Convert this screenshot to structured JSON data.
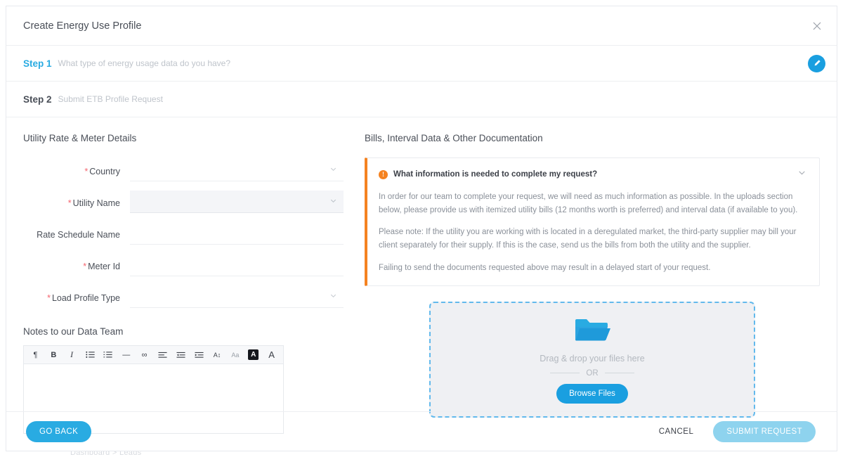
{
  "header": {
    "title": "Create Energy Use Profile",
    "close_icon": "close-icon"
  },
  "steps": [
    {
      "label": "Step 1",
      "subtitle": "What type of energy usage data do you have?",
      "badge_icon": "edit-pencil-icon"
    },
    {
      "label": "Step 2",
      "subtitle": "Submit ETB Profile Request"
    }
  ],
  "left": {
    "section_title": "Utility Rate & Meter Details",
    "fields": [
      {
        "label": "Country",
        "required": true,
        "type": "select",
        "value": "",
        "placeholder": ""
      },
      {
        "label": "Utility Name",
        "required": true,
        "type": "select",
        "value": "",
        "placeholder": ""
      },
      {
        "label": "Rate Schedule Name",
        "required": false,
        "type": "text",
        "value": "",
        "placeholder": ""
      },
      {
        "label": "Meter Id",
        "required": true,
        "type": "text",
        "value": "",
        "placeholder": ""
      },
      {
        "label": "Load Profile Type",
        "required": true,
        "type": "select",
        "value": "",
        "placeholder": ""
      }
    ],
    "notes_title": "Notes to our Data Team",
    "toolbar": [
      {
        "name": "paragraph-icon",
        "glyph": "¶"
      },
      {
        "name": "bold-icon",
        "glyph": "B"
      },
      {
        "name": "italic-icon",
        "glyph": "I"
      },
      {
        "name": "bullet-list-icon",
        "glyph": "☰"
      },
      {
        "name": "numbered-list-icon",
        "glyph": "☷"
      },
      {
        "name": "horizontal-rule-icon",
        "glyph": "—"
      },
      {
        "name": "link-icon",
        "glyph": "∞"
      },
      {
        "name": "align-left-icon",
        "glyph": "≡"
      },
      {
        "name": "outdent-icon",
        "glyph": "←"
      },
      {
        "name": "indent-icon",
        "glyph": "→"
      },
      {
        "name": "font-size-icon",
        "glyph": "A↕"
      },
      {
        "name": "text-case-icon",
        "glyph": "Aa"
      },
      {
        "name": "highlight-color-icon",
        "glyph": "A"
      },
      {
        "name": "text-color-icon",
        "glyph": "A"
      }
    ],
    "editor_value": ""
  },
  "right": {
    "section_title": "Bills, Interval Data & Other Documentation",
    "info": {
      "icon": "info-icon",
      "heading": "What information is needed to complete my request?",
      "chevron_icon": "chevron-down-icon",
      "paragraphs": [
        "In order for our team to complete your request, we will need as much information as possible. In the uploads section below, please provide us with itemized utility bills (12 months worth is preferred) and interval data (if available to you).",
        "Please note: If the utility you are working with is located in a deregulated market, the third-party supplier may bill your client separately for their supply. If this is the case, send us the bills from both the utility and the supplier.",
        "Failing to send the documents requested above may result in a delayed start of your request."
      ]
    },
    "dropzone": {
      "folder_icon": "open-folder-icon",
      "drag_text": "Drag & drop your files here",
      "or_text": "OR",
      "browse_label": "Browse Files"
    }
  },
  "footer": {
    "go_back": "GO BACK",
    "cancel": "CANCEL",
    "submit": "SUBMIT REQUEST"
  },
  "background": {
    "ghost_line": "Dashboard > Leads"
  },
  "colors": {
    "accent_blue": "#29abe2",
    "badge_blue": "#1a9fe0",
    "submit_disabled_blue": "#8ed3ee",
    "info_orange": "#f58220",
    "required_red": "#f5656f",
    "dropzone_border": "#62b9ec"
  }
}
